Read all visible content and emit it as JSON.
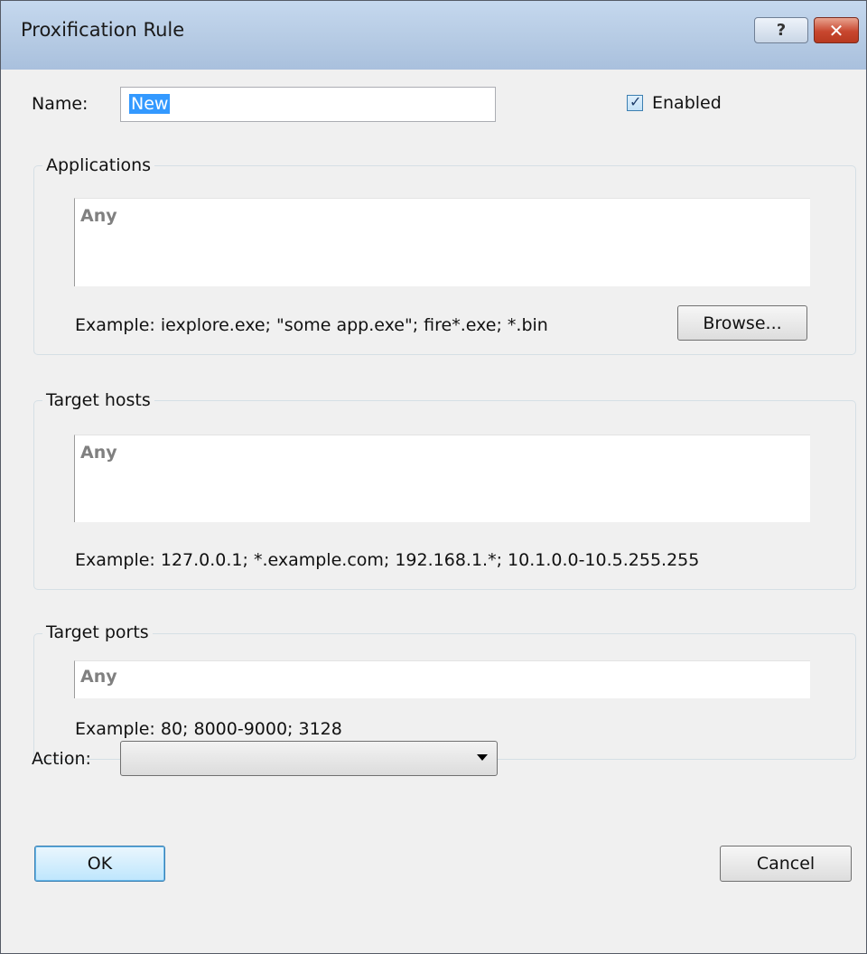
{
  "window": {
    "title": "Proxification Rule",
    "help_glyph": "?",
    "close_glyph": "✕"
  },
  "name": {
    "label": "Name:",
    "value": "New"
  },
  "enabled": {
    "label": "Enabled",
    "checked": true,
    "check_glyph": "✓"
  },
  "applications": {
    "title": "Applications",
    "value": "Any",
    "example": "Example: iexplore.exe; \"some app.exe\"; fire*.exe; *.bin",
    "browse_label": "Browse..."
  },
  "target_hosts": {
    "title": "Target hosts",
    "value": "Any",
    "example": "Example: 127.0.0.1; *.example.com; 192.168.1.*; 10.1.0.0-10.5.255.255"
  },
  "target_ports": {
    "title": "Target ports",
    "value": "Any",
    "example": "Example: 80; 8000-9000; 3128"
  },
  "action": {
    "label": "Action:",
    "value": ""
  },
  "buttons": {
    "ok": "OK",
    "cancel": "Cancel"
  },
  "colors": {
    "titlebar": "#b6cbe4",
    "selection": "#3399ff",
    "close": "#c8472f",
    "dialog_bg": "#f0f0f0"
  }
}
